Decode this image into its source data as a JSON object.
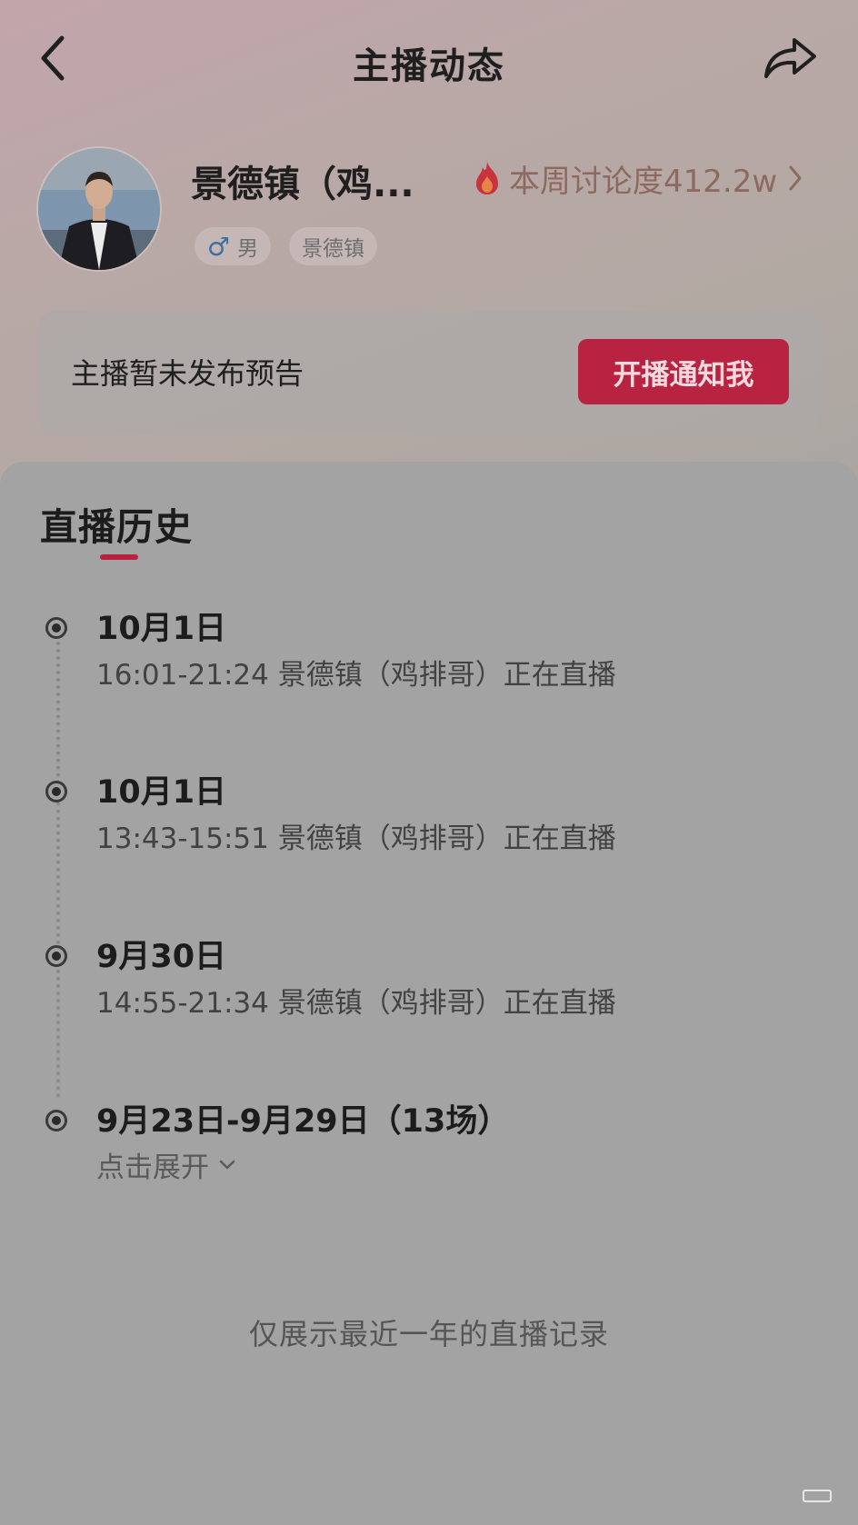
{
  "header": {
    "title": "主播动态"
  },
  "profile": {
    "name": "景德镇（鸡...",
    "heat_label": "本周讨论度412.2w",
    "gender": "男",
    "location": "景德镇"
  },
  "notice": {
    "text": "主播暂未发布预告",
    "button_label": "开播通知我"
  },
  "history": {
    "title": "直播历史",
    "entries": [
      {
        "date": "10月1日",
        "detail": "16:01-21:24 景德镇（鸡排哥）正在直播"
      },
      {
        "date": "10月1日",
        "detail": "13:43-15:51 景德镇（鸡排哥）正在直播"
      },
      {
        "date": "9月30日",
        "detail": "14:55-21:34 景德镇（鸡排哥）正在直播"
      },
      {
        "date": "9月23日-9月29日（13场）",
        "expand_label": "点击展开"
      }
    ],
    "footer_note": "仅展示最近一年的直播记录"
  },
  "colors": {
    "accent": "#b92342",
    "heat_text": "#8c6a60",
    "gender_icon": "#3f6fa0"
  },
  "icons": [
    "back-arrow-icon",
    "share-icon",
    "flame-icon",
    "chevron-right-icon",
    "male-icon",
    "chevron-down-icon"
  ]
}
